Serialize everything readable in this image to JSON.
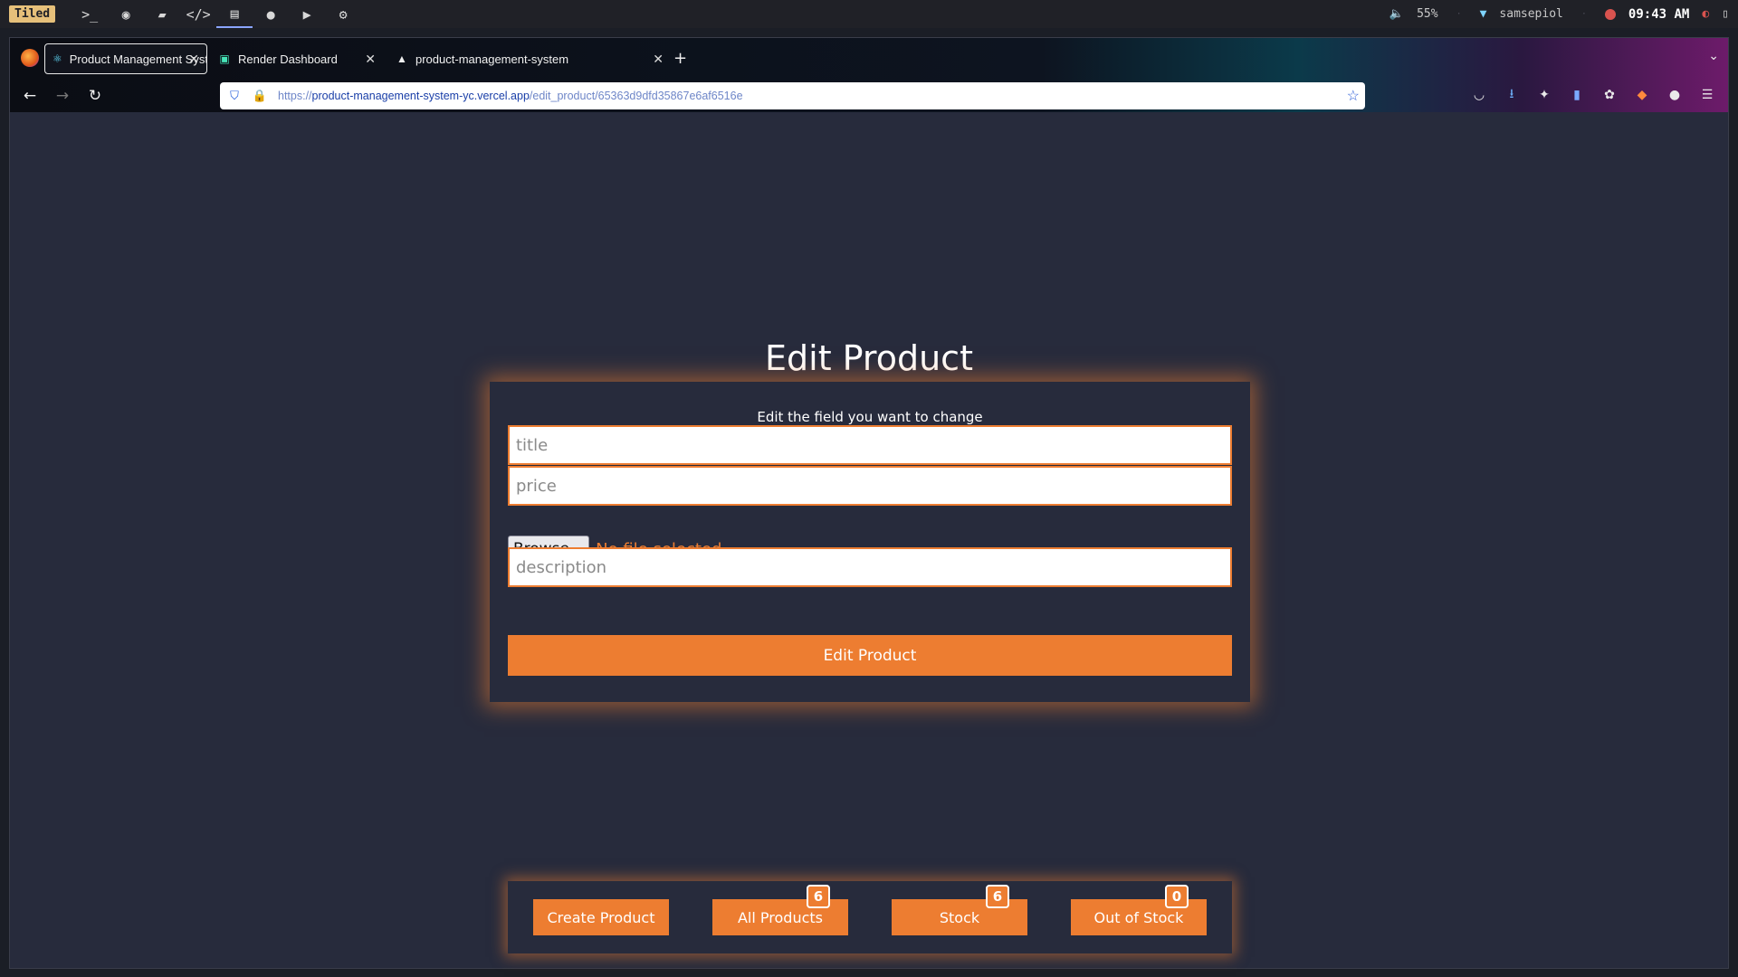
{
  "desktop": {
    "mode": "Tiled",
    "panel_icons": [
      "terminal-icon",
      "firefox-icon",
      "folder-icon",
      "code-icon",
      "notes-icon",
      "chat-icon",
      "youtube-icon",
      "settings-icon"
    ],
    "volume": "55%",
    "network": "samsepiol",
    "time": "09:43 AM"
  },
  "browser": {
    "tabs": [
      {
        "title": "Product Management System",
        "icon": "react-icon",
        "active": true
      },
      {
        "title": "Render Dashboard",
        "icon": "render-icon",
        "active": false
      },
      {
        "title": "product-management-system",
        "icon": "vercel-icon",
        "active": false
      }
    ],
    "url": {
      "scheme": "https://",
      "host": "product-management-system-yc.vercel.app",
      "path": "/edit_product/65363d9dfd35867e6af6516e"
    }
  },
  "page": {
    "title": "Edit Product",
    "subtitle": "Edit the field you want to change",
    "title_placeholder": "title",
    "price_placeholder": "price",
    "browse_label": "Browse...",
    "file_status": "No file selected.",
    "description_placeholder": "description",
    "submit_label": "Edit Product",
    "accent_color": "#ed7d31",
    "background_color": "#272b3c"
  },
  "bottom_nav": {
    "create": {
      "label": "Create Product"
    },
    "all": {
      "label": "All Products",
      "count": "6"
    },
    "stock": {
      "label": "Stock",
      "count": "6"
    },
    "out": {
      "label": "Out of Stock",
      "count": "0"
    }
  }
}
